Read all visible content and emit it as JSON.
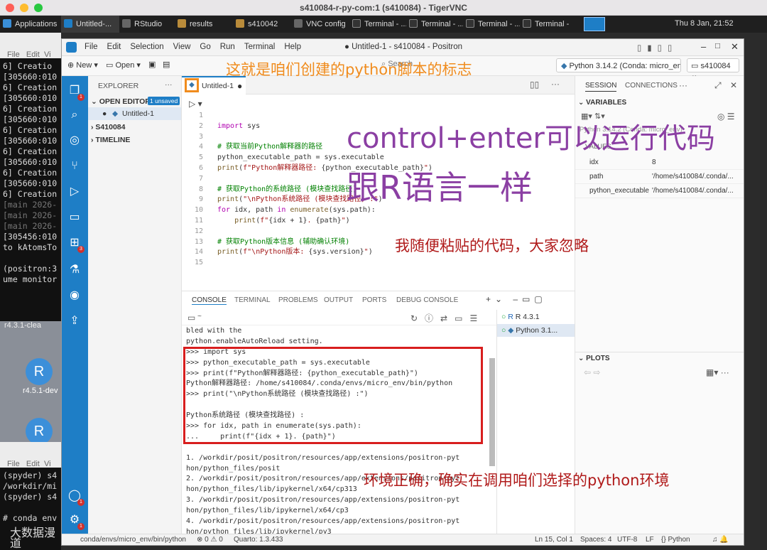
{
  "mac": {
    "title": "s410084-r-py-com:1 (s410084) - TigerVNC"
  },
  "taskbar": {
    "applications": "Applications",
    "tasks": [
      "Untitled-...",
      "RStudio",
      "results",
      "s410042",
      "VNC config",
      "Terminal - ...",
      "Terminal - ...",
      "Terminal - ...",
      "Terminal -"
    ],
    "clock": "Thu  8 Jan, 21:52"
  },
  "bg_terminal": {
    "menu": [
      "File",
      "Edit",
      "Vi"
    ],
    "lines": [
      "6] Creatio",
      "[305660:010",
      "6] Creation",
      "[305660:010",
      "6] Creation",
      "[305660:010",
      "6] Creation",
      "[305660:010",
      "6] Creation",
      "[305660:010",
      "6] Creation",
      "[305660:010",
      "6] Creation",
      "[main 2026-",
      "[main 2026-",
      "[main 2026-",
      "[305456:010",
      "to kAtomsTo",
      "",
      "(positron:3",
      "ume monitor"
    ],
    "status": "r4.3.1-clea"
  },
  "bg_desktop": {
    "icon_label_1": "r4.5.1-dev",
    "icon_letter": "R"
  },
  "bg_terminal2": {
    "menu": [
      "File",
      "Edit",
      "Vi"
    ],
    "lines": [
      "(spyder) s4",
      "/workdir/mi",
      "(spyder) s4",
      "",
      "# conda env"
    ],
    "watermark": "大数据漫道"
  },
  "window": {
    "menu": [
      "File",
      "Edit",
      "Selection",
      "View",
      "Go",
      "Run",
      "Terminal",
      "Help"
    ],
    "title": "● Untitled-1 - s410084 - Positron"
  },
  "toolbar": {
    "new": "New",
    "open": "Open",
    "search": "Search",
    "interpreter": "Python 3.14.2 (Conda: micro_env)",
    "workspace": "s410084"
  },
  "explorer": {
    "header": "EXPLORER",
    "open_editors": "OPEN EDITORS",
    "unsaved_badge": "1 unsaved",
    "file": "Untitled-1",
    "folder": "S410084",
    "timeline": "TIMELINE"
  },
  "editor": {
    "tab": "Untitled-1",
    "lines": [
      {
        "n": "1",
        "html": ""
      },
      {
        "n": "2",
        "html": "<span class='kw'>import</span> sys"
      },
      {
        "n": "3",
        "html": ""
      },
      {
        "n": "4",
        "html": "<span class='cm'># 获取当前Python解释器的路径</span>"
      },
      {
        "n": "5",
        "html": "python_executable_path = sys.executable"
      },
      {
        "n": "6",
        "html": "<span class='fn'>print</span>(<span class='st'>f\"Python解释器路径: </span>{python_executable_path}<span class='st'>\"</span>)"
      },
      {
        "n": "7",
        "html": ""
      },
      {
        "n": "8",
        "html": "<span class='cm'># 获取Python的系统路径 (模块查找路径)</span>"
      },
      {
        "n": "9",
        "html": "<span class='fn'>print</span>(<span class='st'>\"\\nPython系统路径 (模块查找路径) :\"</span>)"
      },
      {
        "n": "10",
        "html": "<span class='kw'>for</span> idx, path <span class='kw'>in</span> <span class='fn'>enumerate</span>(sys.path):"
      },
      {
        "n": "11",
        "html": "    <span class='fn'>print</span>(<span class='st'>f\"</span>{idx + 1}<span class='st'>. </span>{path}<span class='st'>\"</span>)"
      },
      {
        "n": "12",
        "html": ""
      },
      {
        "n": "13",
        "html": "<span class='cm'># 获取Python版本信息 (辅助确认环境)</span>"
      },
      {
        "n": "14",
        "html": "<span class='fn'>print</span>(<span class='st'>f\"\\nPython版本: </span>{sys.version}<span class='st'>\"</span>)"
      },
      {
        "n": "15",
        "html": ""
      }
    ]
  },
  "panel": {
    "tabs": [
      "CONSOLE",
      "TERMINAL",
      "PROBLEMS",
      "OUTPUT",
      "PORTS",
      "DEBUG CONSOLE"
    ],
    "path": "~",
    "console": [
      "bled with the",
      "python.enableAutoReload setting.",
      ">>> import sys",
      ">>> python_executable_path = sys.executable",
      ">>> print(f\"Python解释器路径: {python_executable_path}\")",
      "Python解释器路径: /home/s410084/.conda/envs/micro_env/bin/python",
      ">>> print(\"\\nPython系统路径 (模块查找路径) :\")",
      "",
      "Python系统路径 (模块查找路径) :",
      ">>> for idx, path in enumerate(sys.path):",
      "...     print(f\"{idx + 1}. {path}\")",
      "",
      "1. /workdir/posit/positron/resources/app/extensions/positron-pyt",
      "hon/python_files/posit",
      "2. /workdir/posit/positron/resources/app/extensions/positron-pyt",
      "hon/python_files/lib/ipykernel/x64/cp313",
      "3. /workdir/posit/positron/resources/app/extensions/positron-pyt",
      "hon/python_files/lib/ipykernel/x64/cp3",
      "4. /workdir/posit/positron/resources/app/extensions/positron-pyt",
      "hon/python_files/lib/ipykernel/py3"
    ],
    "sessions": [
      "R 4.3.1",
      "Python 3.1..."
    ]
  },
  "right": {
    "tabs": [
      "SESSION",
      "CONNECTIONS"
    ],
    "variables": "VARIABLES",
    "values": "VALUES",
    "session_select": "Python 3.14.2 (Conda: micro_env)",
    "vars": [
      {
        "name": "idx",
        "value": "8"
      },
      {
        "name": "path",
        "value": "'/home/s410084/.conda/..."
      },
      {
        "name": "python_executable_path",
        "value": "'/home/s410084/.conda/..."
      }
    ],
    "plots": "PLOTS"
  },
  "statusbar": {
    "env": "conda/envs/micro_env/bin/python",
    "problems": "⊗ 0  ⚠ 0",
    "quarto": "Quarto: 1.3.433",
    "position": "Ln 15, Col 1",
    "spaces": "Spaces: 4",
    "encoding": "UTF-8",
    "eol": "LF",
    "language": "{} Python"
  },
  "annotations": {
    "logo": "这就是咱们创建的python脚本的标志",
    "run1": "control+enter可以运行代码",
    "run2": "跟R语言一样",
    "ignore": "我随便粘贴的代码，大家忽略",
    "env": "环境正确，确实在调用咱们选择的python环境"
  },
  "colors": {
    "accent": "#1e7ec6",
    "annotation_orange": "#f08c1e",
    "annotation_purple": "#8b3fa3",
    "highlight_red": "#d81e1e"
  }
}
